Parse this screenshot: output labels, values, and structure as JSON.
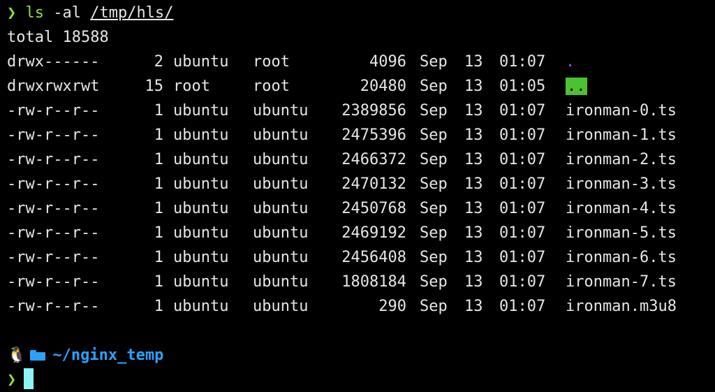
{
  "terminal": {
    "prompt_symbol": "❯",
    "command": "ls",
    "flags": "-al",
    "path_arg": "/tmp/hls/",
    "total": "total 18588",
    "rows": [
      {
        "perms": "drwx------",
        "links": "2",
        "owner": "ubuntu",
        "group": "root",
        "size": "4096",
        "month": "Sep",
        "day": "13",
        "time": "01:07",
        "name": ".",
        "kind": "dot"
      },
      {
        "perms": "drwxrwxrwt",
        "links": "15",
        "owner": "root",
        "group": "root",
        "size": "20480",
        "month": "Sep",
        "day": "13",
        "time": "01:05",
        "name": "..",
        "kind": "dotdot"
      },
      {
        "perms": "-rw-r--r--",
        "links": "1",
        "owner": "ubuntu",
        "group": "ubuntu",
        "size": "2389856",
        "month": "Sep",
        "day": "13",
        "time": "01:07",
        "name": "ironman-0.ts",
        "kind": "file"
      },
      {
        "perms": "-rw-r--r--",
        "links": "1",
        "owner": "ubuntu",
        "group": "ubuntu",
        "size": "2475396",
        "month": "Sep",
        "day": "13",
        "time": "01:07",
        "name": "ironman-1.ts",
        "kind": "file"
      },
      {
        "perms": "-rw-r--r--",
        "links": "1",
        "owner": "ubuntu",
        "group": "ubuntu",
        "size": "2466372",
        "month": "Sep",
        "day": "13",
        "time": "01:07",
        "name": "ironman-2.ts",
        "kind": "file"
      },
      {
        "perms": "-rw-r--r--",
        "links": "1",
        "owner": "ubuntu",
        "group": "ubuntu",
        "size": "2470132",
        "month": "Sep",
        "day": "13",
        "time": "01:07",
        "name": "ironman-3.ts",
        "kind": "file"
      },
      {
        "perms": "-rw-r--r--",
        "links": "1",
        "owner": "ubuntu",
        "group": "ubuntu",
        "size": "2450768",
        "month": "Sep",
        "day": "13",
        "time": "01:07",
        "name": "ironman-4.ts",
        "kind": "file"
      },
      {
        "perms": "-rw-r--r--",
        "links": "1",
        "owner": "ubuntu",
        "group": "ubuntu",
        "size": "2469192",
        "month": "Sep",
        "day": "13",
        "time": "01:07",
        "name": "ironman-5.ts",
        "kind": "file"
      },
      {
        "perms": "-rw-r--r--",
        "links": "1",
        "owner": "ubuntu",
        "group": "ubuntu",
        "size": "2456408",
        "month": "Sep",
        "day": "13",
        "time": "01:07",
        "name": "ironman-6.ts",
        "kind": "file"
      },
      {
        "perms": "-rw-r--r--",
        "links": "1",
        "owner": "ubuntu",
        "group": "ubuntu",
        "size": "1808184",
        "month": "Sep",
        "day": "13",
        "time": "01:07",
        "name": "ironman-7.ts",
        "kind": "file"
      },
      {
        "perms": "-rw-r--r--",
        "links": "1",
        "owner": "ubuntu",
        "group": "ubuntu",
        "size": "290",
        "month": "Sep",
        "day": "13",
        "time": "01:07",
        "name": "ironman.m3u8",
        "kind": "file"
      }
    ],
    "ps1_user_glyph": "🐧",
    "ps1_icon": "folder-open-icon",
    "ps1_path": "~/nginx_temp",
    "colors": {
      "background": "#000000",
      "text": "#e6e6e6",
      "prompt": "#8ce13a",
      "dir_dot": "#6a6aff",
      "dir_dotdot_bg": "#4cc230",
      "ps1_path": "#2aa1ff",
      "cursor": "#8ef3f5"
    }
  }
}
